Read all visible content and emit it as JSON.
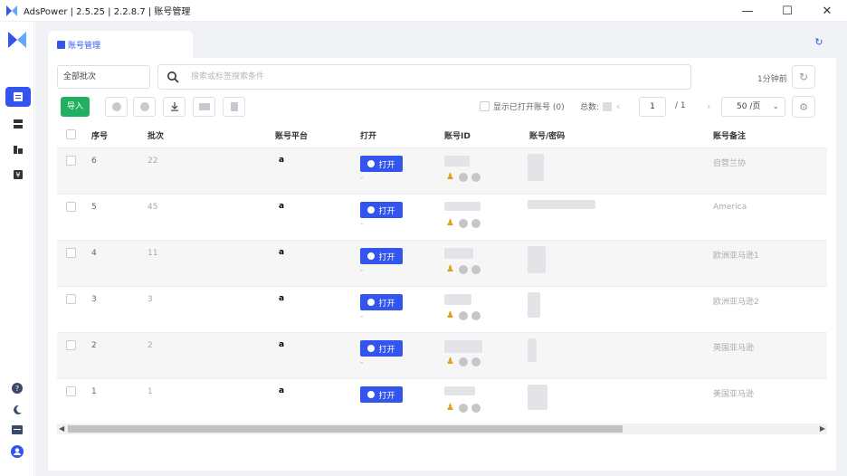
{
  "window": {
    "title": "AdsPower | 2.5.25 | 2.2.8.7 | 账号管理",
    "minimize": "—",
    "maximize": "☐",
    "close": "✕"
  },
  "tab": {
    "label": "账号管理"
  },
  "toolbar": {
    "batch_select": "全部批次",
    "search_placeholder": "搜索或标签搜索条件",
    "auto_refresh": "1分钟前",
    "import_label": "导入",
    "show_open_label": "显示已打开账号 (0)",
    "total_label": "总数:",
    "page_current": "1",
    "page_total": "/ 1",
    "page_size": "50 /页"
  },
  "table": {
    "headers": [
      "序号",
      "批次",
      "账号平台",
      "打开",
      "账号ID",
      "账号/密码",
      "账号备注"
    ],
    "open_label": "打开",
    "platform_mark": "a",
    "rows": [
      {
        "index": "6",
        "batch": "22",
        "note": "自营兰协",
        "sub": "-"
      },
      {
        "index": "5",
        "batch": "45",
        "note": "America",
        "sub": "-"
      },
      {
        "index": "4",
        "batch": "11",
        "note": "欧洲亚马逊1",
        "sub": "-"
      },
      {
        "index": "3",
        "batch": "3",
        "note": "欧洲亚马逊2",
        "sub": "-"
      },
      {
        "index": "2",
        "batch": "2",
        "note": "英国亚马逊",
        "sub": "-"
      },
      {
        "index": "1",
        "batch": "1",
        "note": "美国亚马逊",
        "sub": ""
      }
    ]
  },
  "icons": {
    "app_logo": "adspower-logo-icon",
    "sidebar": [
      "account-icon",
      "list-icon",
      "chart-icon",
      "billing-icon"
    ],
    "sidebar_bottom": [
      "help-icon",
      "moon-icon",
      "message-icon",
      "user-icon"
    ]
  },
  "colors": {
    "accent": "#3355ee",
    "import_green": "#20b060"
  }
}
